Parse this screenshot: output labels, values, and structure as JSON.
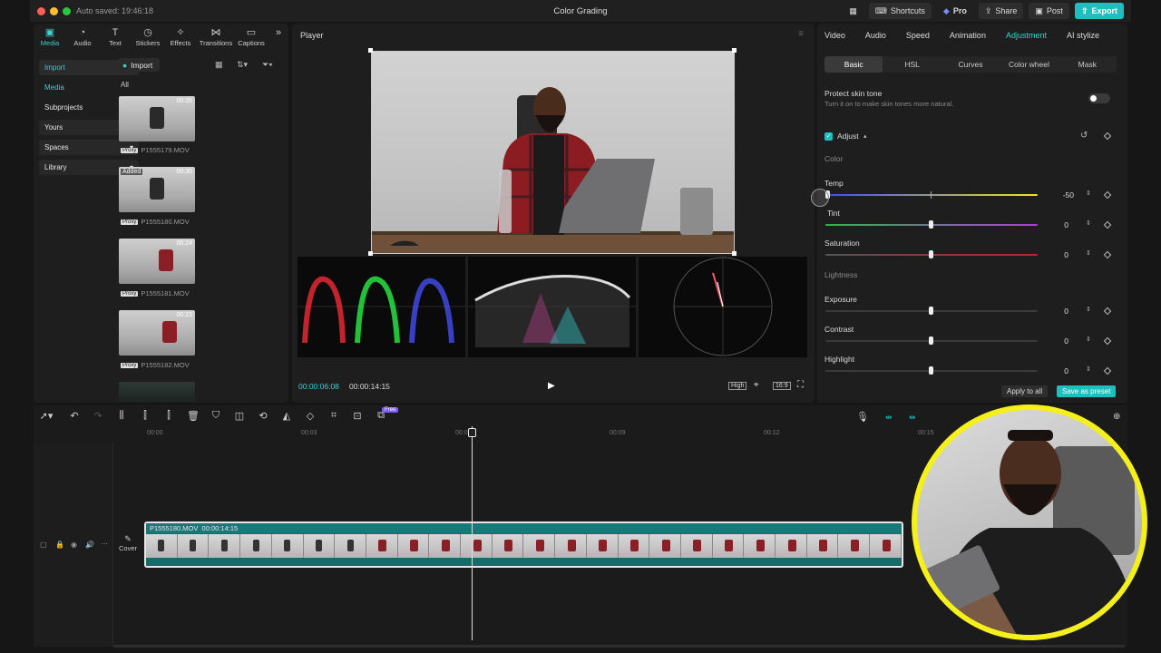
{
  "titlebar": {
    "autosave": "Auto saved: 19:46:18",
    "title": "Color Grading",
    "shortcuts": "Shortcuts",
    "pro": "Pro",
    "share": "Share",
    "post": "Post",
    "export": "Export"
  },
  "media_tabs": [
    {
      "label": "Media",
      "icon": "media-icon"
    },
    {
      "label": "Audio",
      "icon": "audio-icon"
    },
    {
      "label": "Text",
      "icon": "text-icon"
    },
    {
      "label": "Stickers",
      "icon": "stickers-icon"
    },
    {
      "label": "Effects",
      "icon": "effects-icon"
    },
    {
      "label": "Transitions",
      "icon": "transitions-icon"
    },
    {
      "label": "Captions",
      "icon": "captions-icon"
    }
  ],
  "sidebar": {
    "import": "Import",
    "media": "Media",
    "subprojects": "Subprojects",
    "yours": "Yours",
    "spaces": "Spaces",
    "library": "Library"
  },
  "media_panel": {
    "import_button": "Import",
    "all": "All",
    "items": [
      {
        "duration": "00:26",
        "name": "P1555179.MOV",
        "badge": "Proxy",
        "added": ""
      },
      {
        "duration": "00:30",
        "name": "P1555180.MOV",
        "badge": "Proxy",
        "added": "Added"
      },
      {
        "duration": "00:24",
        "name": "P1555181.MOV",
        "badge": "Proxy",
        "added": ""
      },
      {
        "duration": "00:23",
        "name": "P1555182.MOV",
        "badge": "Proxy",
        "added": ""
      }
    ]
  },
  "player": {
    "title": "Player",
    "current_time": "00:00:06:08",
    "total_time": "00:00:14:15",
    "quality": "High",
    "ratio": "16:9"
  },
  "right_panel": {
    "tabs": [
      "Video",
      "Audio",
      "Speed",
      "Animation",
      "Adjustment",
      "AI stylize"
    ],
    "active_tab": "Adjustment",
    "subtabs": [
      "Basic",
      "HSL",
      "Curves",
      "Color wheel",
      "Mask"
    ],
    "protect_title": "Protect skin tone",
    "protect_desc": "Turn it on to make skin tones more natural.",
    "adjust_label": "Adjust",
    "color_section": "Color",
    "lightness_section": "Lightness",
    "sliders": {
      "temp": {
        "label": "Temp",
        "value": "-50"
      },
      "tint": {
        "label": "Tint",
        "value": "0"
      },
      "saturation": {
        "label": "Saturation",
        "value": "0"
      },
      "exposure": {
        "label": "Exposure",
        "value": "0"
      },
      "contrast": {
        "label": "Contrast",
        "value": "0"
      },
      "highlight": {
        "label": "Highlight",
        "value": "0"
      }
    },
    "apply_all": "Apply to all",
    "save_preset": "Save as preset"
  },
  "timeline": {
    "ruler": [
      "00:00",
      "00:03",
      "00:06",
      "00:09",
      "00:12",
      "00:15"
    ],
    "clip_name": "P1555180.MOV",
    "clip_duration": "00:00:14:15",
    "cover": "Cover",
    "free_badge": "Free"
  },
  "colors": {
    "accent": "#1fbfbf",
    "webcam_ring": "#f5ef1a"
  }
}
